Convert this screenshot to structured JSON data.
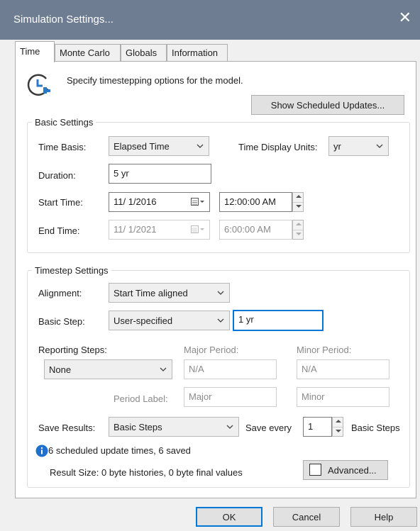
{
  "title": "Simulation Settings...",
  "tabs": [
    "Time",
    "Monte Carlo",
    "Globals",
    "Information"
  ],
  "header": {
    "description": "Specify timestepping options for the model.",
    "show_updates": "Show Scheduled Updates..."
  },
  "basic": {
    "title": "Basic Settings",
    "time_basis_label": "Time Basis:",
    "time_basis_value": "Elapsed Time",
    "display_units_label": "Time Display Units:",
    "display_units_value": "yr",
    "duration_label": "Duration:",
    "duration_value": "5 yr",
    "start_label": "Start Time:",
    "start_date": "11/ 1/2016",
    "start_time": "12:00:00 AM",
    "end_label": "End Time:",
    "end_date": "11/ 1/2021",
    "end_time": "6:00:00 AM"
  },
  "timestep": {
    "title": "Timestep Settings",
    "alignment_label": "Alignment:",
    "alignment_value": "Start Time aligned",
    "step_label": "Basic Step:",
    "step_value": "User-specified",
    "step_input": "1 yr",
    "reporting_label": "Reporting Steps:",
    "reporting_value": "None",
    "major_label": "Major Period:",
    "major_value": "N/A",
    "minor_label": "Minor Period:",
    "minor_value": "N/A",
    "period_label": "Period Label:",
    "major_name": "Major",
    "minor_name": "Minor",
    "save_label": "Save Results:",
    "save_value": "Basic Steps",
    "save_every_label": "Save every",
    "save_every_value": "1",
    "save_every_units": "Basic Steps"
  },
  "info": {
    "updates": "6 scheduled update times, 6 saved",
    "result_size": "Result Size: 0 byte histories, 0 byte final values",
    "advanced": "Advanced..."
  },
  "footer": {
    "ok": "OK",
    "cancel": "Cancel",
    "help": "Help"
  }
}
